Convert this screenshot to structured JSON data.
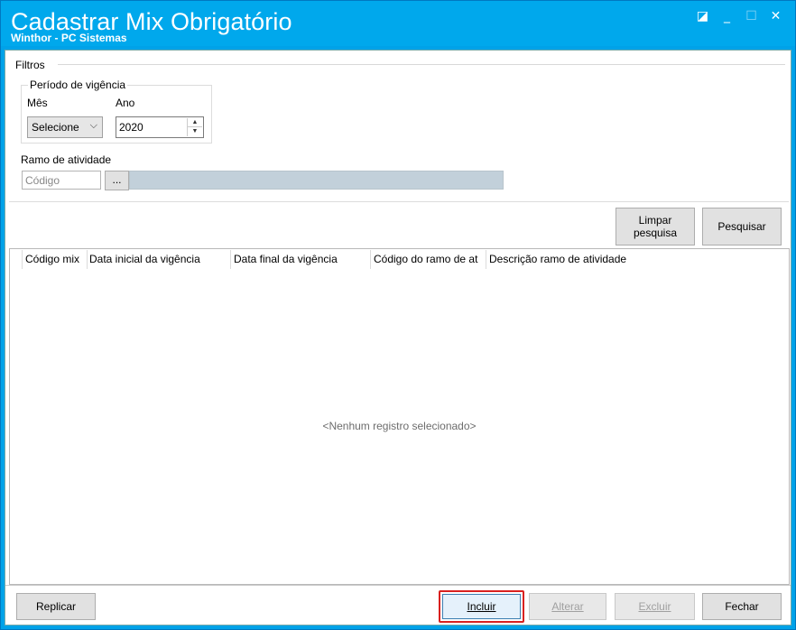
{
  "window": {
    "title": "Cadastrar Mix Obrigatório",
    "subtitle": "Winthor - PC Sistemas",
    "controls": [
      "restore-icon",
      "minimize-icon",
      "maximize-icon",
      "close-icon"
    ]
  },
  "filtros": {
    "legend": "Filtros",
    "periodo": {
      "legend": "Período de vigência",
      "mes_label": "Mês",
      "mes_value": "Selecione",
      "ano_label": "Ano",
      "ano_value": "2020"
    },
    "ramo": {
      "label": "Ramo de atividade",
      "codigo_placeholder": "Código",
      "lookup_button": "...",
      "description_value": ""
    }
  },
  "actions": {
    "limpar_line1": "Limpar",
    "limpar_line2": "pesquisa",
    "pesquisar": "Pesquisar"
  },
  "grid": {
    "columns": [
      "Código mix",
      "Data inicial da vigência",
      "Data final da vigência",
      "Código do ramo de at",
      "Descrição ramo de atividade"
    ],
    "empty_message": "<Nenhum registro selecionado>"
  },
  "footer": {
    "replicar": "Replicar",
    "incluir": "Incluir",
    "alterar": "Alterar",
    "excluir": "Excluir",
    "fechar": "Fechar"
  },
  "colors": {
    "titlebar": "#00a8ec",
    "highlight": "#d9211f",
    "description_field": "#c2d0da"
  }
}
